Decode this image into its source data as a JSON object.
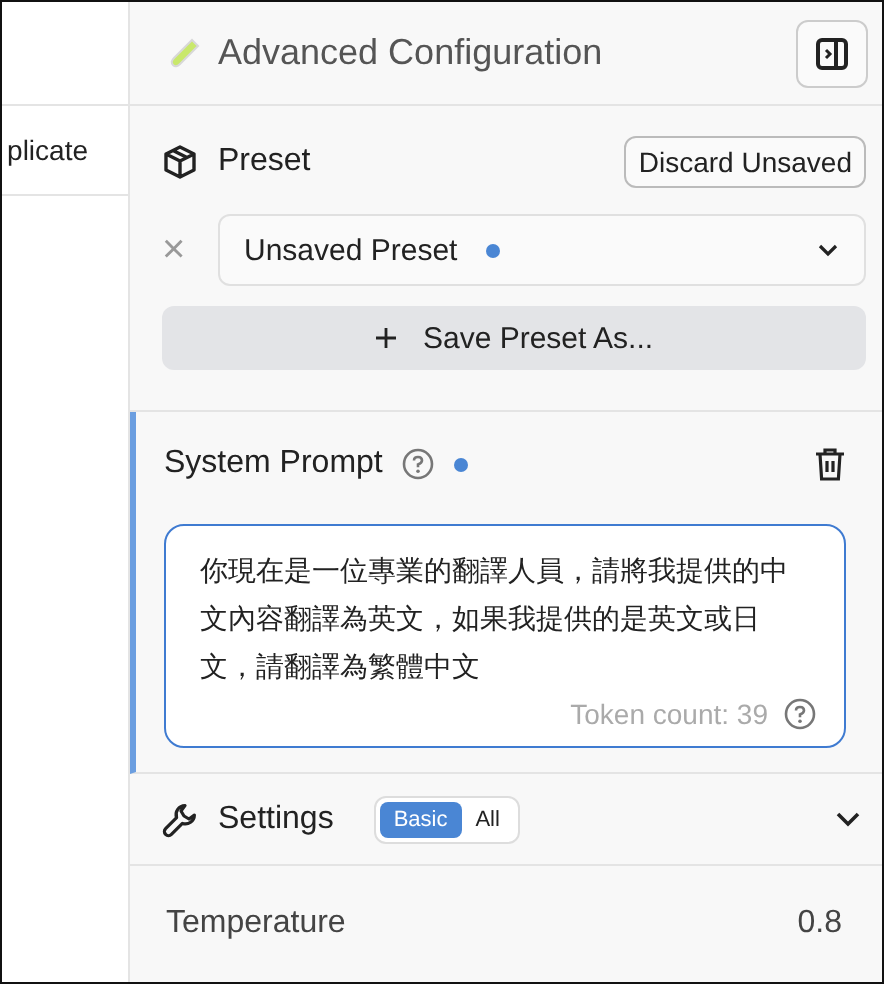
{
  "left_panel": {
    "item": "plicate"
  },
  "header": {
    "title": "Advanced Configuration"
  },
  "preset": {
    "label": "Preset",
    "discard_button": "Discard Unsaved",
    "clear": "×",
    "selected_preset": "Unsaved Preset",
    "unsaved": true,
    "save_button": "Save Preset As..."
  },
  "system_prompt": {
    "title": "System Prompt",
    "modified": true,
    "value": "你現在是一位專業的翻譯人員，請將我提供的中文內容翻譯為英文，如果我提供的是英文或日文，請翻譯為繁體中文",
    "token_count": "Token count: 39"
  },
  "settings": {
    "title": "Settings",
    "tabs": [
      {
        "label": "Basic",
        "selected": true
      },
      {
        "label": "All",
        "selected": false
      }
    ]
  },
  "temperature": {
    "label": "Temperature",
    "value": "0.8"
  }
}
